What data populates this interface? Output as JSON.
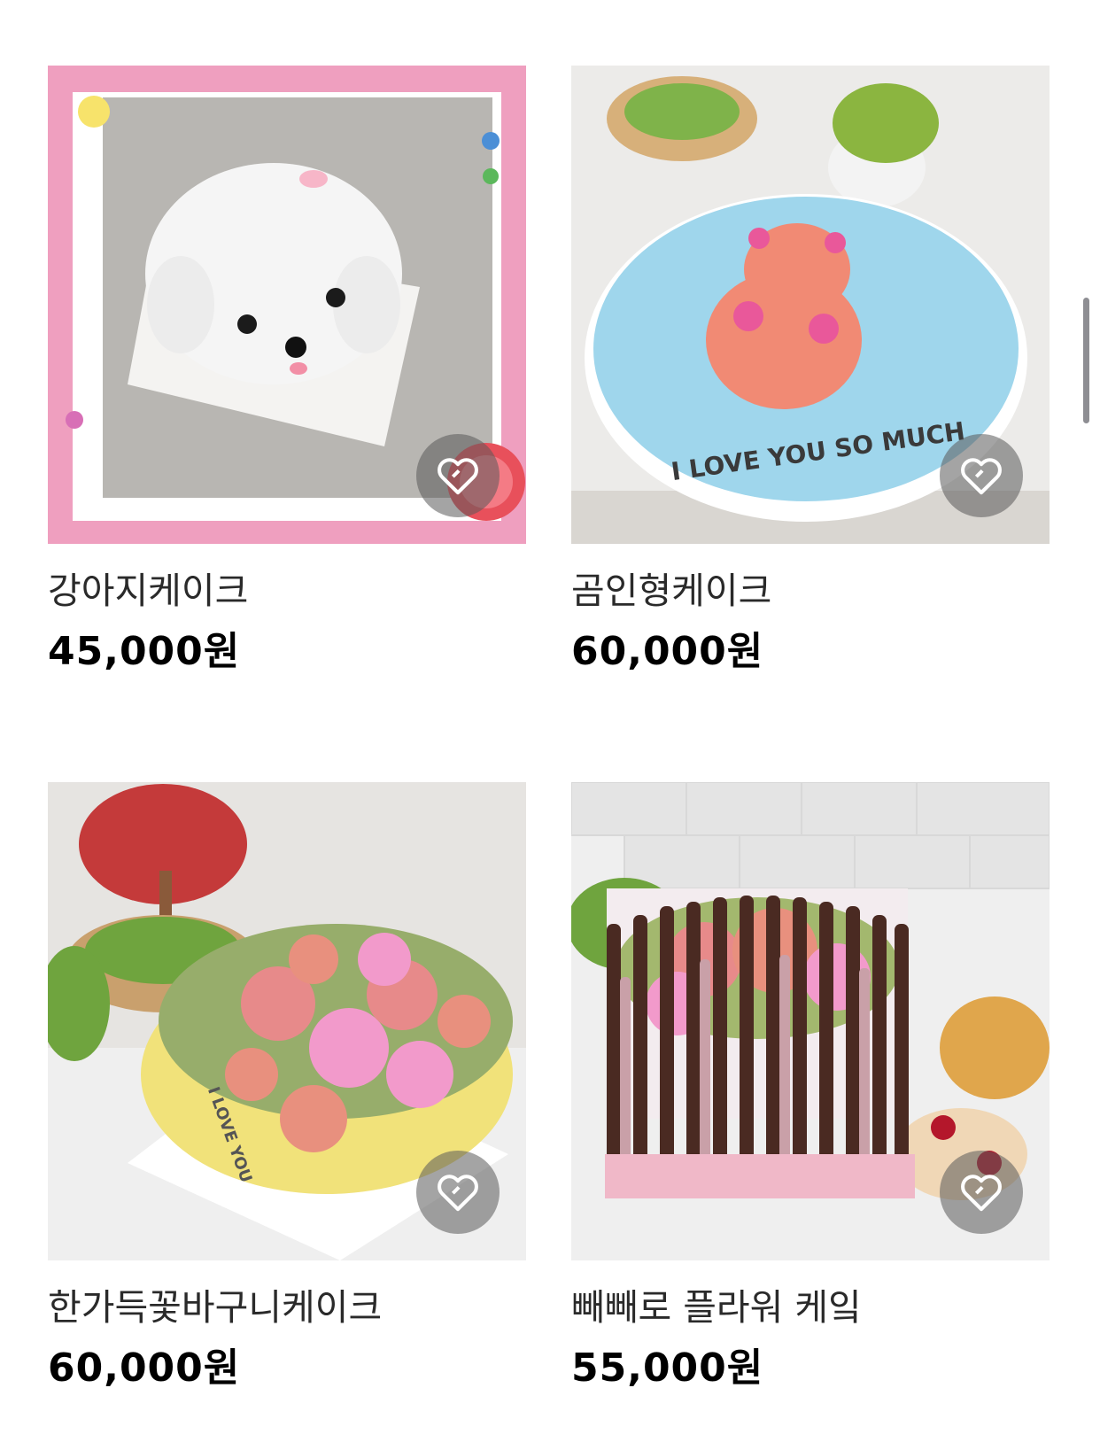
{
  "products": [
    {
      "name": "강아지케이크",
      "price": "45,000원",
      "image_icon": "dog-cake-photo"
    },
    {
      "name": "곰인형케이크",
      "price": "60,000원",
      "image_icon": "bear-cake-photo",
      "cake_text": "I LOVE YOU SO MUCH"
    },
    {
      "name": "한가득꽃바구니케이크",
      "price": "60,000원",
      "image_icon": "flower-basket-cake-photo",
      "cake_text": "I LOVE YOU"
    },
    {
      "name": "빼빼로 플라워 케잌",
      "price": "55,000원",
      "image_icon": "pepero-flower-cake-photo"
    }
  ],
  "like_icon": "heart-icon",
  "colors": {
    "price_text": "#000000",
    "name_text": "#2a2a2a",
    "like_button_bg": "#5a5a5a",
    "scrollbar": "#8e8e93"
  }
}
